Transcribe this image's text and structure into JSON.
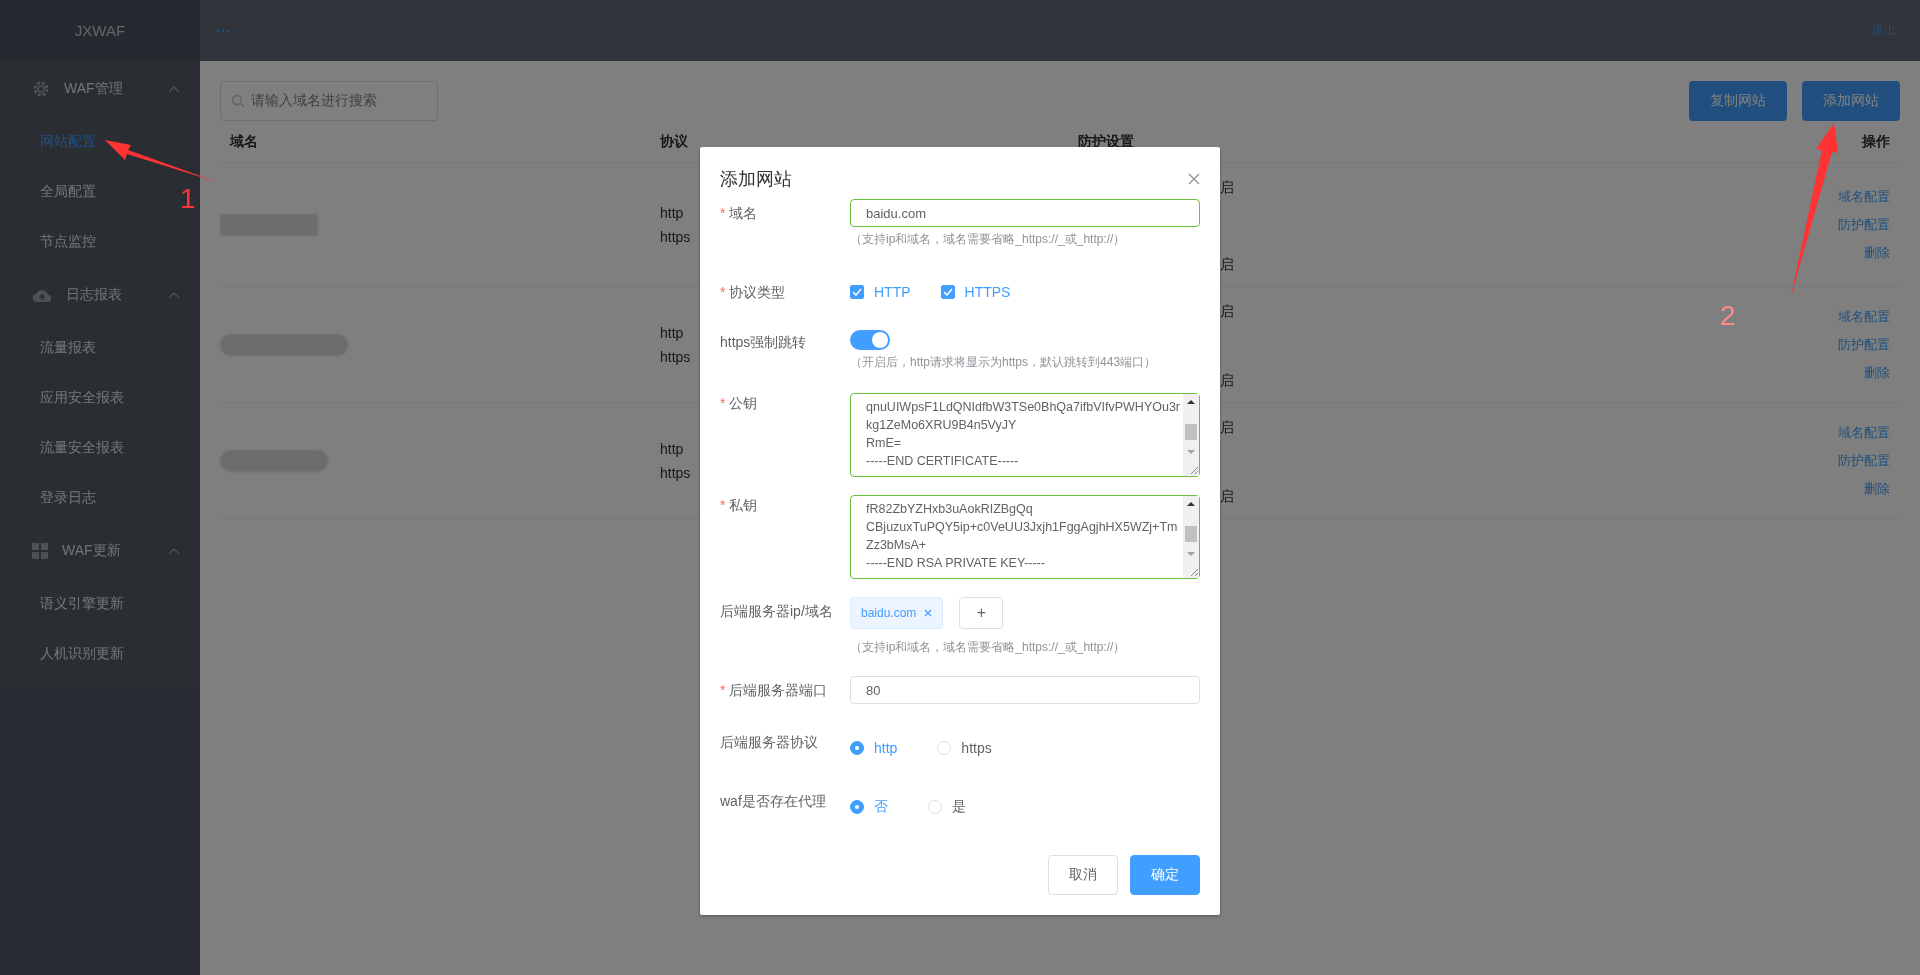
{
  "app": {
    "logo": "JXWAF",
    "logout": "退出"
  },
  "sidebar": {
    "groups": [
      {
        "label": "WAF管理",
        "expanded": true,
        "items": [
          {
            "label": "网站配置",
            "selected": true
          },
          {
            "label": "全局配置",
            "selected": false
          },
          {
            "label": "节点监控",
            "selected": false
          }
        ]
      },
      {
        "label": "日志报表",
        "expanded": true,
        "items": [
          {
            "label": "流量报表",
            "selected": false
          },
          {
            "label": "应用安全报表",
            "selected": false
          },
          {
            "label": "流量安全报表",
            "selected": false
          },
          {
            "label": "登录日志",
            "selected": false
          }
        ]
      },
      {
        "label": "WAF更新",
        "expanded": true,
        "items": [
          {
            "label": "语义引擎更新",
            "selected": false
          },
          {
            "label": "人机识别更新",
            "selected": false
          }
        ]
      }
    ]
  },
  "toolbar": {
    "search_placeholder": "请输入域名进行搜索",
    "buttons": [
      "复制网站",
      "添加网站"
    ]
  },
  "table": {
    "columns": [
      "域名",
      "协议",
      "防护设置",
      "操作"
    ],
    "rows": [
      {
        "protocols": [
          "http",
          "https"
        ],
        "protection": [
          "启",
          "启"
        ],
        "actions": [
          "域名配置",
          "防护配置",
          "删除"
        ]
      },
      {
        "protocols": [
          "http",
          "https"
        ],
        "protection": [
          "启",
          "启"
        ],
        "actions": [
          "域名配置",
          "防护配置",
          "删除"
        ]
      },
      {
        "protocols": [
          "http",
          "https"
        ],
        "protection": [
          "启",
          "启"
        ],
        "actions": [
          "域名配置",
          "防护配置",
          "删除"
        ]
      }
    ]
  },
  "dialog": {
    "title": "添加网站",
    "fields": [
      {
        "kind": "text",
        "label": "域名",
        "required_mark": "*",
        "value": "baidu.com",
        "validated": true,
        "hint": "（支持ip和域名，域名需要省略_https://_或_http://）"
      },
      {
        "kind": "checkboxes",
        "label": "协议类型",
        "required_mark": "*",
        "options": [
          {
            "label": "HTTP",
            "checked": true
          },
          {
            "label": "HTTPS",
            "checked": true
          }
        ]
      },
      {
        "kind": "switch",
        "label": "https强制跳转",
        "on": true,
        "hint": "（开启后，http请求将显示为https，默认跳转到443端口）"
      },
      {
        "kind": "textarea",
        "label": "公钥",
        "required_mark": "*",
        "validated": true,
        "lines": [
          "qnuUIWpsF1LdQNIdfbW3TSe0BhQa7ifbVIfvPWHYOu3r",
          "kg1ZeMo6XRU9B4n5VyJY",
          "RmE=",
          "-----END CERTIFICATE-----"
        ]
      },
      {
        "kind": "textarea",
        "label": "私钥",
        "required_mark": "*",
        "validated": true,
        "lines": [
          "fR82ZbYZHxb3uAokRIZBgQq",
          "CBjuzuxTuPQY5ip+c0VeUU3Jxjh1FggAgjhHX5WZj+Tm",
          "Zz3bMsA+",
          "-----END RSA PRIVATE KEY-----"
        ]
      },
      {
        "kind": "tags",
        "label": "后端服务器ip/域名",
        "tags": [
          "baidu.com"
        ],
        "add_button": "+",
        "hint": "（支持ip和域名，域名需要省略_https://_或_http://）"
      },
      {
        "kind": "text",
        "label": "后端服务器端口",
        "required_mark": "*",
        "value": "80",
        "validated": false
      },
      {
        "kind": "radios",
        "label": "后端服务器协议",
        "options": [
          {
            "label": "http",
            "selected": true
          },
          {
            "label": "https",
            "selected": false
          }
        ]
      },
      {
        "kind": "radios",
        "label": "waf是否存在代理",
        "options": [
          {
            "label": "否",
            "selected": true
          },
          {
            "label": "是",
            "selected": false
          }
        ]
      }
    ],
    "buttons": [
      {
        "label": "取消",
        "primary": false
      },
      {
        "label": "确定",
        "primary": true
      }
    ]
  },
  "annotations": [
    {
      "label": "1"
    },
    {
      "label": "2"
    }
  ]
}
